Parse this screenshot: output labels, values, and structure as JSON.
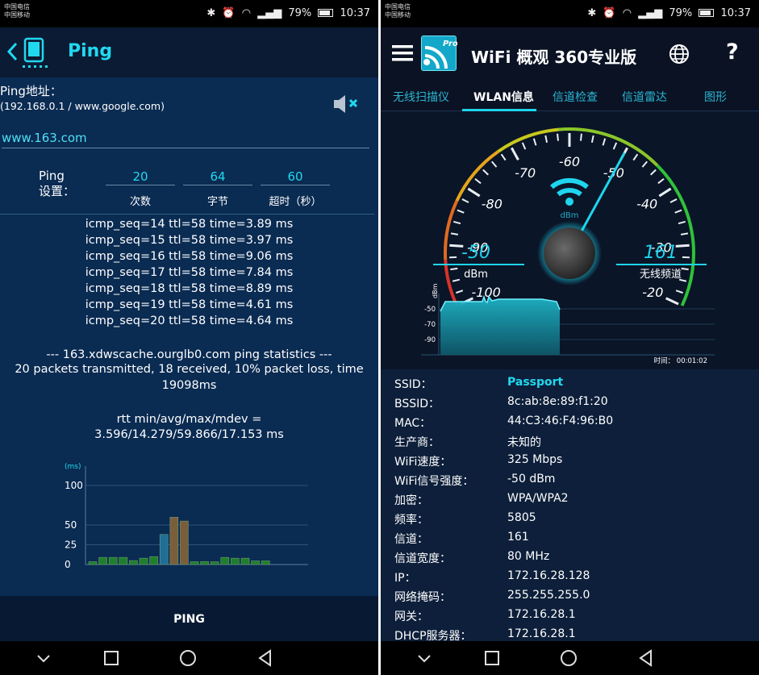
{
  "status_bar": {
    "carrier1": "中国电信",
    "carrier2": "中国移动",
    "signal_text": "⁴⁶ᴳ",
    "battery": "79%",
    "time": "10:37"
  },
  "ping_app": {
    "title": "Ping",
    "address_label": "Ping地址：",
    "address_hint": "(192.168.0.1 / www.google.com)",
    "url_value": "www.163.com",
    "settings_label_line1": "Ping",
    "settings_label_line2": "设置：",
    "settings": [
      {
        "value": "20",
        "caption": "次数"
      },
      {
        "value": "64",
        "caption": "字节"
      },
      {
        "value": "60",
        "caption": "超时（秒）"
      }
    ],
    "log_lines": [
      "icmp_seq=14 ttl=58 time=3.89 ms",
      "icmp_seq=15 ttl=58 time=3.97 ms",
      "icmp_seq=16 ttl=58 time=9.06 ms",
      "icmp_seq=17 ttl=58 time=7.84 ms",
      "icmp_seq=18 ttl=58 time=8.89 ms",
      "icmp_seq=19 ttl=58 time=4.61 ms",
      "icmp_seq=20 ttl=58 time=4.64 ms"
    ],
    "stats_header": "--- 163.xdwscache.ourglb0.com ping statistics ---",
    "stats_packets_line1": "20 packets transmitted, 18 received, 10% packet loss, time",
    "stats_packets_line2": "19098ms",
    "rtt_label": "rtt min/avg/max/mdev =",
    "rtt_values": "3.596/14.279/59.866/17.153 ms",
    "button_label": "PING"
  },
  "chart_data": {
    "type": "bar",
    "ylabel": "(ms)",
    "y_ticks": [
      0,
      25,
      50,
      100
    ],
    "values": [
      3.596,
      9,
      9,
      9,
      5,
      8,
      10,
      38,
      59.866,
      55,
      3.6,
      3.8,
      3.5,
      9,
      8,
      8,
      4.6,
      4.6
    ],
    "colors": [
      "#1e7e2c",
      "#1e7e2c",
      "#1e7e2c",
      "#1e7e2c",
      "#1e7e2c",
      "#1e7e2c",
      "#1e7e2c",
      "#1e6e98",
      "#7a5e3c",
      "#7a5e3c",
      "#1e7e2c",
      "#1e7e2c",
      "#1e7e2c",
      "#1e7e2c",
      "#1e7e2c",
      "#1e7e2c",
      "#1e7e2c",
      "#1e7e2c"
    ]
  },
  "wifi_app": {
    "title": "WiFi 概观 360专业版",
    "logo_badge": "Pro",
    "help": "?",
    "tabs": [
      "无线扫描仪",
      "WLAN信息",
      "信道检查",
      "信道雷达",
      "图形"
    ],
    "active_tab": 1,
    "gauge": {
      "ticks": [
        "-100",
        "-90",
        "-80",
        "-70",
        "-60",
        "-50",
        "-40",
        "-30",
        "-20"
      ],
      "value": -50,
      "signal_value": "-50",
      "signal_unit": "dBm",
      "center_unit": "dBm",
      "channel_value": "161",
      "channel_label": "无线频道"
    },
    "history": {
      "unit": "dBm",
      "y_ticks": [
        "-50",
        "-70",
        "-90"
      ],
      "time_label": "时间： 00:01:02"
    },
    "info": [
      {
        "k": "SSID：",
        "v": "Passport",
        "accent": true
      },
      {
        "k": "BSSID：",
        "v": "8c:ab:8e:89:f1:20"
      },
      {
        "k": "MAC：",
        "v": "44:C3:46:F4:96:B0"
      },
      {
        "k": "生产商：",
        "v": "未知的"
      },
      {
        "k": "WiFi速度：",
        "v": "325 Mbps"
      },
      {
        "k": "WiFi信号强度：",
        "v": "-50 dBm"
      },
      {
        "k": "加密：",
        "v": "WPA/WPA2"
      },
      {
        "k": "频率：",
        "v": "5805"
      },
      {
        "k": "信道：",
        "v": "161"
      },
      {
        "k": "信道宽度：",
        "v": "80 MHz"
      },
      {
        "k": "IP：",
        "v": "172.16.28.128"
      },
      {
        "k": "网络掩码：",
        "v": "255.255.255.0"
      },
      {
        "k": "网关：",
        "v": "172.16.28.1"
      },
      {
        "k": "DHCP服务器：",
        "v": "172.16.28.1"
      }
    ]
  }
}
